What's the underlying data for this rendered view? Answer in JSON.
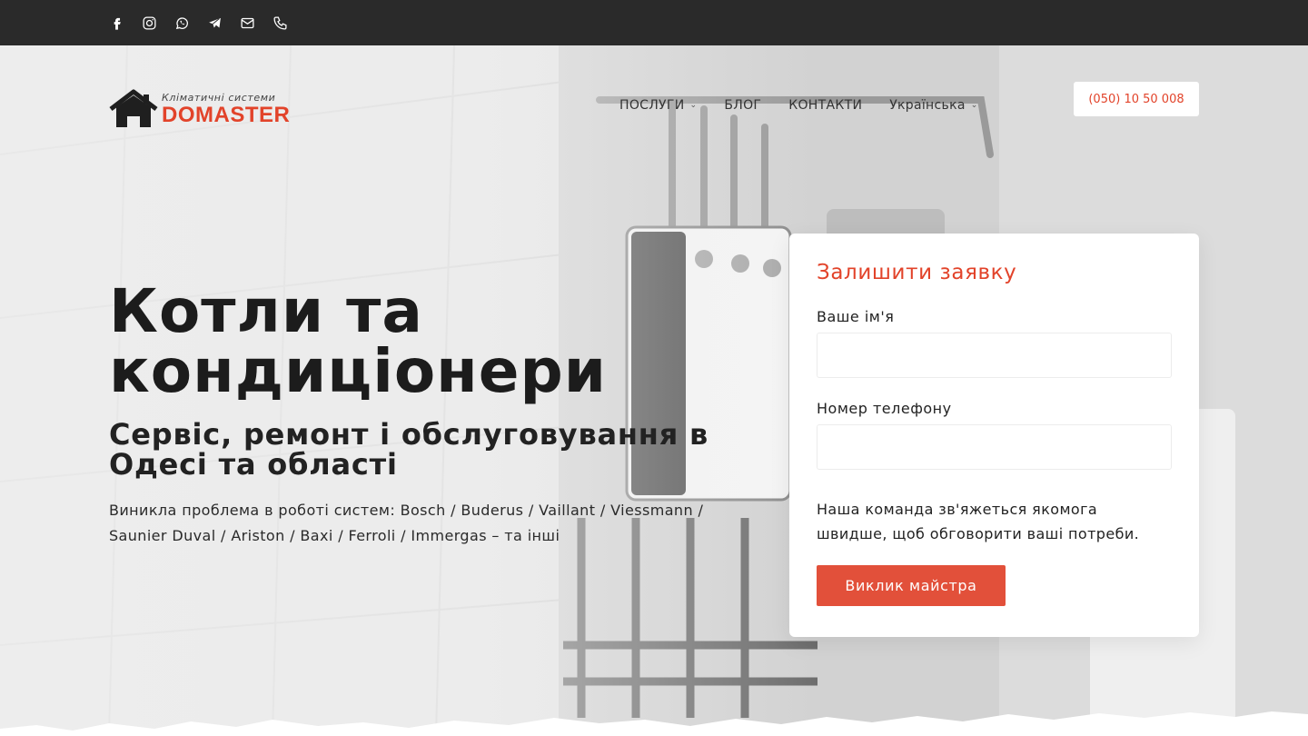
{
  "topbar": {
    "icons": [
      "facebook-icon",
      "instagram-icon",
      "whatsapp-icon",
      "telegram-icon",
      "mail-icon",
      "phone-icon"
    ]
  },
  "logo": {
    "tagline": "Кліматичні системи",
    "name": "DOMASTER"
  },
  "nav": {
    "items": [
      {
        "label": "ПОСЛУГИ",
        "dropdown": true
      },
      {
        "label": "БЛОГ",
        "dropdown": false
      },
      {
        "label": "КОНТАКТИ",
        "dropdown": false
      },
      {
        "label": "Українська",
        "dropdown": true
      }
    ]
  },
  "header": {
    "phone": "(050) 10 50 008"
  },
  "hero": {
    "title": "Котли та кондиціонери",
    "subtitle": "Сервіс, ремонт і обслуговування в Одесі та області",
    "description": "Виникла проблема в роботі систем: Bosch / Buderus / Vaillant / Viessmann / Saunier Duval / Ariston / Baxi / Ferroli / Immergas – та інші"
  },
  "form": {
    "title": "Залишити заявку",
    "name_label": "Ваше ім'я",
    "name_value": "",
    "phone_label": "Номер телефону",
    "phone_value": "",
    "note": "Наша команда зв'яжеться якомога швидше, щоб обговорити ваші потреби.",
    "submit_label": "Виклик майстра"
  },
  "colors": {
    "accent": "#e2432a",
    "topbar": "#2a2a2a"
  }
}
